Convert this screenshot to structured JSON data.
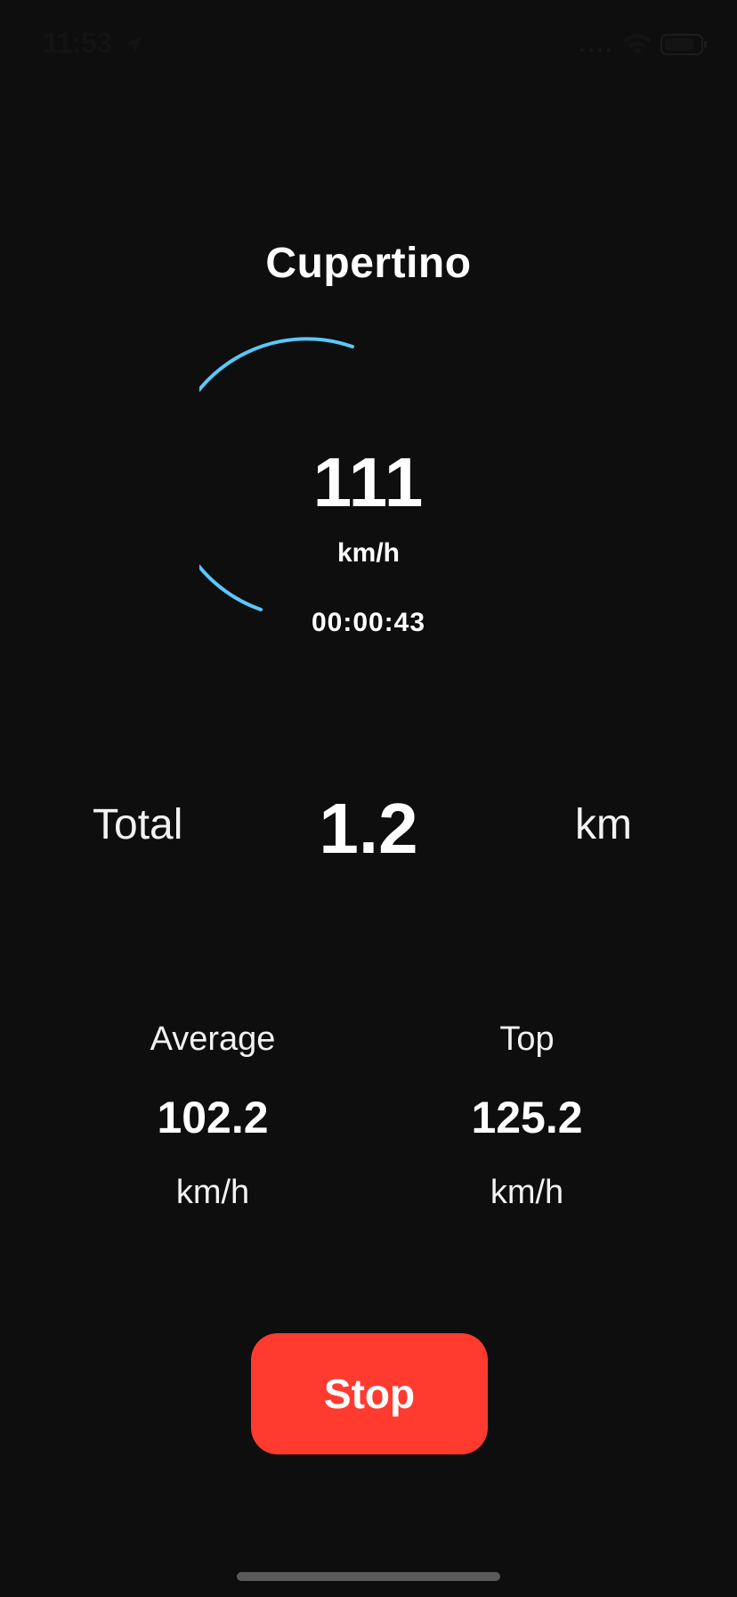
{
  "status_bar": {
    "time": "11:53",
    "icons": [
      "location-arrow-icon",
      "cellular-signal-icon",
      "wifi-icon",
      "battery-icon"
    ]
  },
  "header": {
    "city": "Cupertino"
  },
  "gauge": {
    "speed": "111",
    "unit": "km/h",
    "elapsed": "00:00:43",
    "arc_color": "#5ac8fa"
  },
  "distance": {
    "label": "Total",
    "value": "1.2",
    "unit": "km"
  },
  "stats": {
    "average": {
      "label": "Average",
      "value": "102.2",
      "unit": "km/h"
    },
    "top": {
      "label": "Top",
      "value": "125.2",
      "unit": "km/h"
    }
  },
  "actions": {
    "stop_label": "Stop",
    "stop_color": "#ff3b30"
  }
}
